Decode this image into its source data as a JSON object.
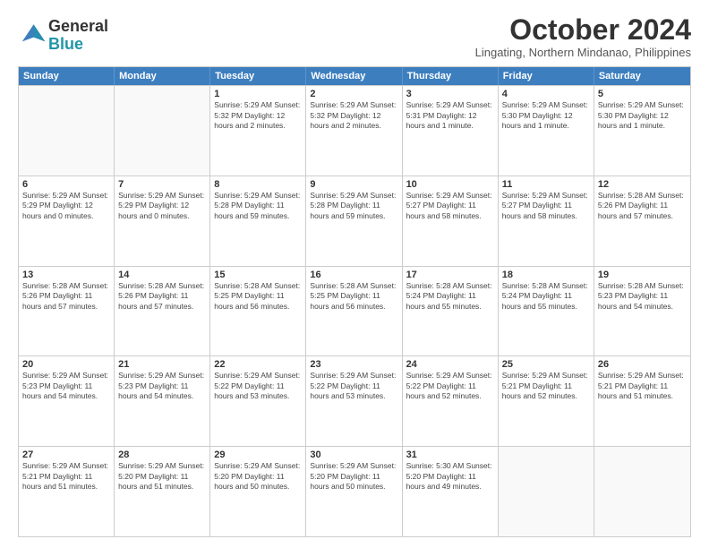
{
  "logo": {
    "line1": "General",
    "line2": "Blue"
  },
  "title": "October 2024",
  "subtitle": "Lingating, Northern Mindanao, Philippines",
  "header_days": [
    "Sunday",
    "Monday",
    "Tuesday",
    "Wednesday",
    "Thursday",
    "Friday",
    "Saturday"
  ],
  "weeks": [
    [
      {
        "day": "",
        "info": ""
      },
      {
        "day": "",
        "info": ""
      },
      {
        "day": "1",
        "info": "Sunrise: 5:29 AM\nSunset: 5:32 PM\nDaylight: 12 hours\nand 2 minutes."
      },
      {
        "day": "2",
        "info": "Sunrise: 5:29 AM\nSunset: 5:32 PM\nDaylight: 12 hours\nand 2 minutes."
      },
      {
        "day": "3",
        "info": "Sunrise: 5:29 AM\nSunset: 5:31 PM\nDaylight: 12 hours\nand 1 minute."
      },
      {
        "day": "4",
        "info": "Sunrise: 5:29 AM\nSunset: 5:30 PM\nDaylight: 12 hours\nand 1 minute."
      },
      {
        "day": "5",
        "info": "Sunrise: 5:29 AM\nSunset: 5:30 PM\nDaylight: 12 hours\nand 1 minute."
      }
    ],
    [
      {
        "day": "6",
        "info": "Sunrise: 5:29 AM\nSunset: 5:29 PM\nDaylight: 12 hours\nand 0 minutes."
      },
      {
        "day": "7",
        "info": "Sunrise: 5:29 AM\nSunset: 5:29 PM\nDaylight: 12 hours\nand 0 minutes."
      },
      {
        "day": "8",
        "info": "Sunrise: 5:29 AM\nSunset: 5:28 PM\nDaylight: 11 hours\nand 59 minutes."
      },
      {
        "day": "9",
        "info": "Sunrise: 5:29 AM\nSunset: 5:28 PM\nDaylight: 11 hours\nand 59 minutes."
      },
      {
        "day": "10",
        "info": "Sunrise: 5:29 AM\nSunset: 5:27 PM\nDaylight: 11 hours\nand 58 minutes."
      },
      {
        "day": "11",
        "info": "Sunrise: 5:29 AM\nSunset: 5:27 PM\nDaylight: 11 hours\nand 58 minutes."
      },
      {
        "day": "12",
        "info": "Sunrise: 5:28 AM\nSunset: 5:26 PM\nDaylight: 11 hours\nand 57 minutes."
      }
    ],
    [
      {
        "day": "13",
        "info": "Sunrise: 5:28 AM\nSunset: 5:26 PM\nDaylight: 11 hours\nand 57 minutes."
      },
      {
        "day": "14",
        "info": "Sunrise: 5:28 AM\nSunset: 5:26 PM\nDaylight: 11 hours\nand 57 minutes."
      },
      {
        "day": "15",
        "info": "Sunrise: 5:28 AM\nSunset: 5:25 PM\nDaylight: 11 hours\nand 56 minutes."
      },
      {
        "day": "16",
        "info": "Sunrise: 5:28 AM\nSunset: 5:25 PM\nDaylight: 11 hours\nand 56 minutes."
      },
      {
        "day": "17",
        "info": "Sunrise: 5:28 AM\nSunset: 5:24 PM\nDaylight: 11 hours\nand 55 minutes."
      },
      {
        "day": "18",
        "info": "Sunrise: 5:28 AM\nSunset: 5:24 PM\nDaylight: 11 hours\nand 55 minutes."
      },
      {
        "day": "19",
        "info": "Sunrise: 5:28 AM\nSunset: 5:23 PM\nDaylight: 11 hours\nand 54 minutes."
      }
    ],
    [
      {
        "day": "20",
        "info": "Sunrise: 5:29 AM\nSunset: 5:23 PM\nDaylight: 11 hours\nand 54 minutes."
      },
      {
        "day": "21",
        "info": "Sunrise: 5:29 AM\nSunset: 5:23 PM\nDaylight: 11 hours\nand 54 minutes."
      },
      {
        "day": "22",
        "info": "Sunrise: 5:29 AM\nSunset: 5:22 PM\nDaylight: 11 hours\nand 53 minutes."
      },
      {
        "day": "23",
        "info": "Sunrise: 5:29 AM\nSunset: 5:22 PM\nDaylight: 11 hours\nand 53 minutes."
      },
      {
        "day": "24",
        "info": "Sunrise: 5:29 AM\nSunset: 5:22 PM\nDaylight: 11 hours\nand 52 minutes."
      },
      {
        "day": "25",
        "info": "Sunrise: 5:29 AM\nSunset: 5:21 PM\nDaylight: 11 hours\nand 52 minutes."
      },
      {
        "day": "26",
        "info": "Sunrise: 5:29 AM\nSunset: 5:21 PM\nDaylight: 11 hours\nand 51 minutes."
      }
    ],
    [
      {
        "day": "27",
        "info": "Sunrise: 5:29 AM\nSunset: 5:21 PM\nDaylight: 11 hours\nand 51 minutes."
      },
      {
        "day": "28",
        "info": "Sunrise: 5:29 AM\nSunset: 5:20 PM\nDaylight: 11 hours\nand 51 minutes."
      },
      {
        "day": "29",
        "info": "Sunrise: 5:29 AM\nSunset: 5:20 PM\nDaylight: 11 hours\nand 50 minutes."
      },
      {
        "day": "30",
        "info": "Sunrise: 5:29 AM\nSunset: 5:20 PM\nDaylight: 11 hours\nand 50 minutes."
      },
      {
        "day": "31",
        "info": "Sunrise: 5:30 AM\nSunset: 5:20 PM\nDaylight: 11 hours\nand 49 minutes."
      },
      {
        "day": "",
        "info": ""
      },
      {
        "day": "",
        "info": ""
      }
    ]
  ]
}
